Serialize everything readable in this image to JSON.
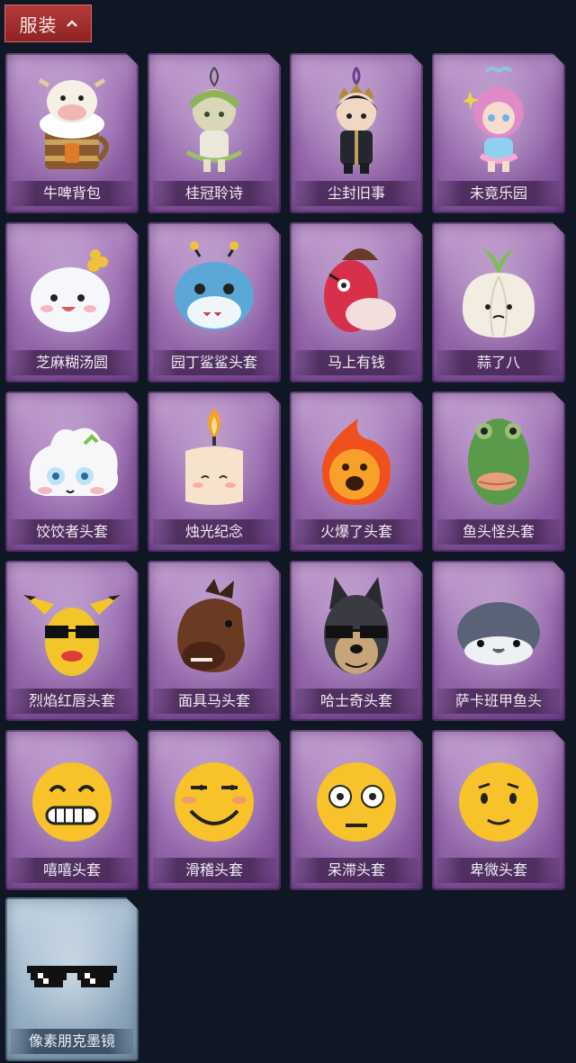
{
  "header": {
    "title": "服装"
  },
  "items": [
    {
      "label": "牛啤背包",
      "icon": "cow-beer-backpack-icon"
    },
    {
      "label": "桂冠聆诗",
      "icon": "laurel-doll-charm-icon"
    },
    {
      "label": "尘封旧事",
      "icon": "dark-prince-doll-charm-icon"
    },
    {
      "label": "未竟乐园",
      "icon": "pink-girl-doll-charm-icon"
    },
    {
      "label": "芝麻糊汤圆",
      "icon": "rice-ball-head-icon"
    },
    {
      "label": "园丁鲨鲨头套",
      "icon": "shark-head-icon"
    },
    {
      "label": "马上有钱",
      "icon": "red-horse-head-icon"
    },
    {
      "label": "蒜了八",
      "icon": "garlic-head-icon"
    },
    {
      "label": "饺饺者头套",
      "icon": "dumpling-head-icon"
    },
    {
      "label": "烛光纪念",
      "icon": "candle-head-icon"
    },
    {
      "label": "火爆了头套",
      "icon": "fireball-head-icon"
    },
    {
      "label": "鱼头怪头套",
      "icon": "fish-monster-head-icon"
    },
    {
      "label": "烈焰红唇头套",
      "icon": "yellow-mouse-sunglasses-head-icon"
    },
    {
      "label": "面具马头套",
      "icon": "horse-mask-head-icon"
    },
    {
      "label": "哈士奇头套",
      "icon": "husky-sunglasses-head-icon"
    },
    {
      "label": "萨卡班甲鱼头",
      "icon": "sacabambaspis-head-icon"
    },
    {
      "label": "嘻嘻头套",
      "icon": "grin-emoji-head-icon"
    },
    {
      "label": "滑稽头套",
      "icon": "funny-emoji-head-icon"
    },
    {
      "label": "呆滞头套",
      "icon": "stunned-emoji-head-icon"
    },
    {
      "label": "卑微头套",
      "icon": "humble-emoji-head-icon"
    },
    {
      "label": "像素朋克墨镜",
      "icon": "pixel-sunglasses-icon"
    }
  ]
}
